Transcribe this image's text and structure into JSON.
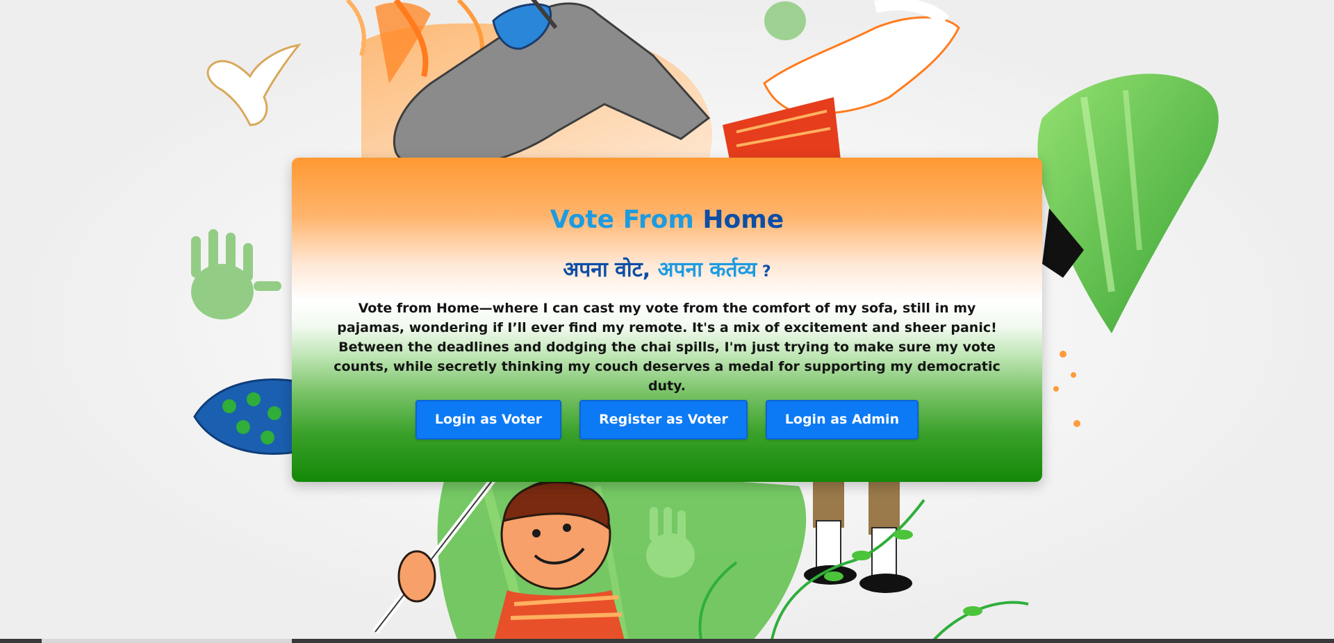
{
  "hero": {
    "title_part1": "Vote From",
    "title_part2": " Home",
    "tagline_part1": "अपना वोट, ",
    "tagline_part2": "अपना कर्तव्य",
    "tagline_part3": " ?",
    "description": "Vote from Home—where I can cast my vote from the comfort of my sofa, still in my pajamas, wondering if I’ll ever find my remote. It's a mix of excitement and sheer panic! Between the deadlines and dodging the chai spills, I'm just trying to make sure my vote counts, while secretly thinking my couch deserves a medal for supporting my democratic duty."
  },
  "buttons": {
    "login_voter": "Login as Voter",
    "register_voter": "Register as Voter",
    "login_admin": "Login as Admin"
  },
  "colors": {
    "saffron": "#ff9933",
    "white": "#ffffff",
    "green": "#138808",
    "title_light_blue": "#1e9be0",
    "title_dark_blue": "#0d4ea6",
    "button_blue": "#0d7af5"
  },
  "decorations": {
    "icons": [
      "dove-icon",
      "fighter-jet-icon",
      "peacock-feather-icon",
      "handprint-icon",
      "boy-with-flag-icon",
      "india-map-icon",
      "vine-icon"
    ]
  }
}
